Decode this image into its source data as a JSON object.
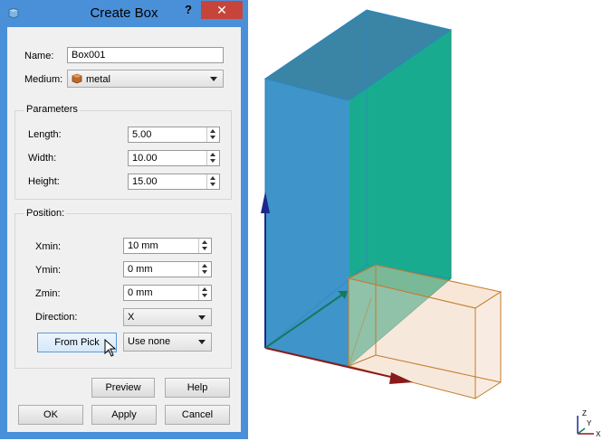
{
  "dialog": {
    "title": "Create Box",
    "help_label": "?",
    "close_label": "✕"
  },
  "form": {
    "name_label": "Name:",
    "name_value": "Box001",
    "medium_label": "Medium:",
    "medium_value": "metal"
  },
  "parameters": {
    "title": "Parameters",
    "length_label": "Length:",
    "length_value": "5.00",
    "width_label": "Width:",
    "width_value": "10.00",
    "height_label": "Height:",
    "height_value": "15.00"
  },
  "position": {
    "title": "Position:",
    "xmin_label": "Xmin:",
    "xmin_value": "10 mm",
    "ymin_label": "Ymin:",
    "ymin_value": "0 mm",
    "zmin_label": "Zmin:",
    "zmin_value": "0 mm",
    "direction_label": "Direction:",
    "direction_value": "X",
    "from_pick_label": "From Pick",
    "use_none_value": "Use none"
  },
  "buttons": {
    "preview": "Preview",
    "help": "Help",
    "ok": "OK",
    "apply": "Apply",
    "cancel": "Cancel"
  },
  "triad": {
    "z": "Z",
    "y": "Y",
    "x": "X"
  },
  "colors": {
    "title_bar": "#4a90d9",
    "close": "#c7443a",
    "box_blue": "#3f94c9",
    "box_green": "#19ab8f",
    "box_copper_edge": "#c57a2c",
    "axis_blue": "#1a2a8c",
    "axis_red": "#8a1a1a"
  }
}
